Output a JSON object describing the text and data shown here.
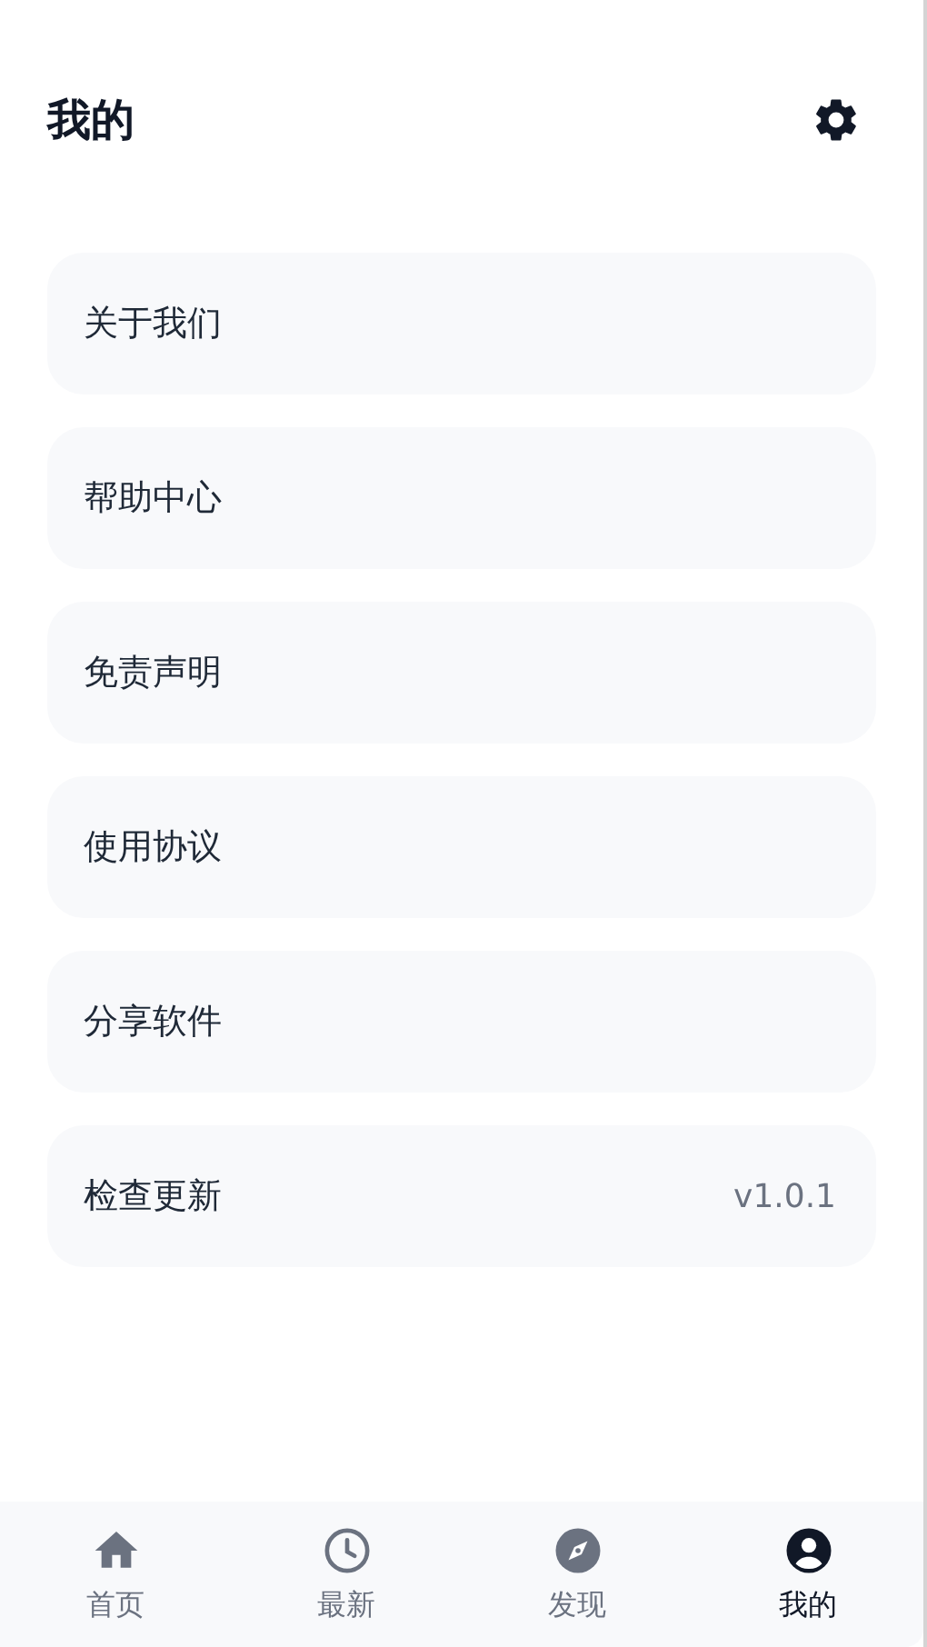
{
  "header": {
    "title": "我的"
  },
  "menu": [
    {
      "label": "关于我们"
    },
    {
      "label": "帮助中心"
    },
    {
      "label": "免责声明"
    },
    {
      "label": "使用协议"
    },
    {
      "label": "分享软件"
    },
    {
      "label": "检查更新",
      "value": "v1.0.1"
    }
  ],
  "tabs": [
    {
      "label": "首页",
      "selected": false
    },
    {
      "label": "最新",
      "selected": false
    },
    {
      "label": "发现",
      "selected": false
    },
    {
      "label": "我的",
      "selected": true
    }
  ]
}
